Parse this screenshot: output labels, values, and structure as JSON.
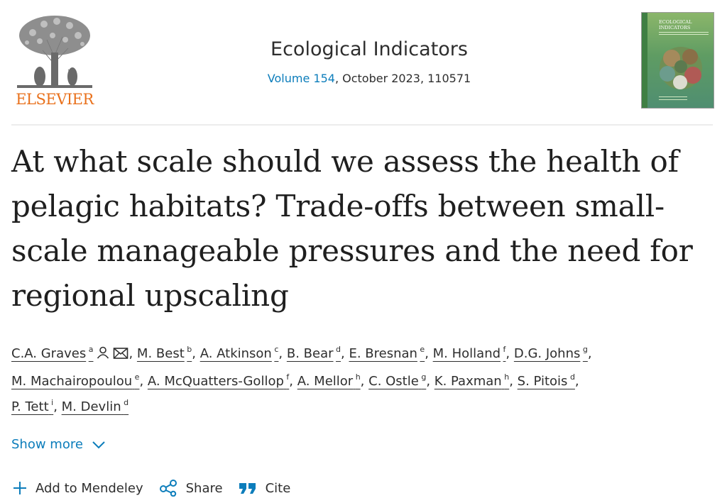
{
  "header": {
    "publisher_logo_text": "ELSEVIER",
    "journal_title": "Ecological Indicators",
    "volume_link": "Volume 154",
    "issue_rest": ", October 2023, 110571",
    "cover_title_line1": "ECOLOGICAL",
    "cover_title_line2": "INDICATORS"
  },
  "article": {
    "title": "At what scale should we assess the health of pelagic habitats? Trade-offs between small-scale manageable pressures and the need for regional upscaling"
  },
  "authors": [
    {
      "name": "C.A. Graves",
      "sup": "a"
    },
    {
      "name": "M. Best",
      "sup": "b"
    },
    {
      "name": "A. Atkinson",
      "sup": "c"
    },
    {
      "name": "B. Bear",
      "sup": "d"
    },
    {
      "name": "E. Bresnan",
      "sup": "e"
    },
    {
      "name": "M. Holland",
      "sup": "f"
    },
    {
      "name": "D.G. Johns",
      "sup": "g"
    },
    {
      "name": "M. Machairopoulou",
      "sup": "e"
    },
    {
      "name": "A. McQuatters-Gollop",
      "sup": "f"
    },
    {
      "name": "A. Mellor",
      "sup": "h"
    },
    {
      "name": "C. Ostle",
      "sup": "g"
    },
    {
      "name": "K. Paxman",
      "sup": "h"
    },
    {
      "name": "S. Pitois",
      "sup": "d"
    },
    {
      "name": "P. Tett",
      "sup": "i"
    },
    {
      "name": "M. Devlin",
      "sup": "d"
    }
  ],
  "show_more_label": "Show more",
  "actions": {
    "mendeley": "Add to Mendeley",
    "share": "Share",
    "cite": "Cite"
  },
  "colors": {
    "link": "#0c7dbb",
    "elsevier_orange": "#e9711c"
  },
  "icons": [
    "person-icon",
    "envelope-icon",
    "chevron-down-icon",
    "plus-icon",
    "share-icon",
    "quote-icon"
  ]
}
